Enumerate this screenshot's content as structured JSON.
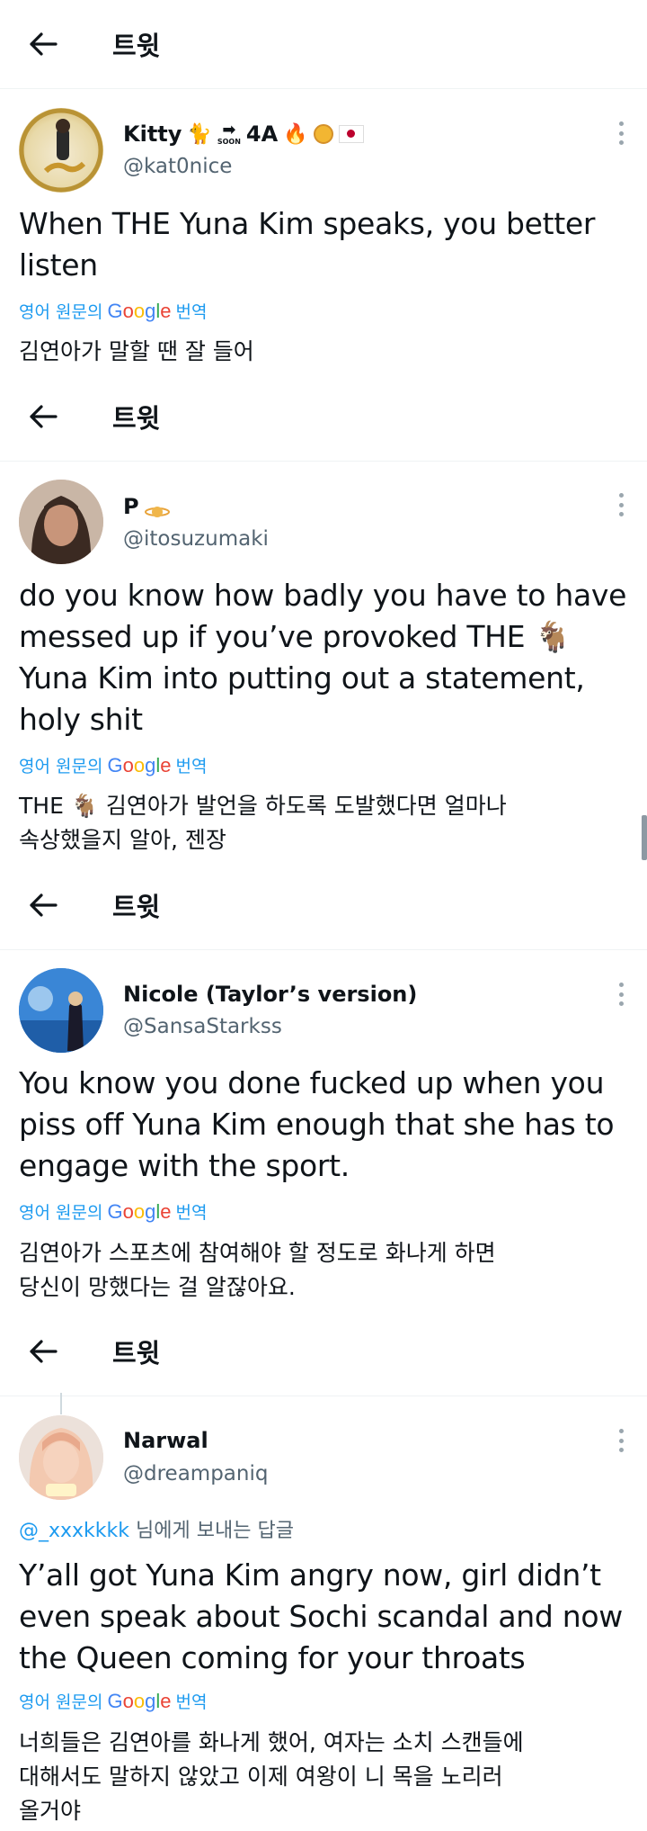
{
  "header_title": "트윗",
  "translate": {
    "prefix": "영어 원문의",
    "google": [
      "G",
      "o",
      "o",
      "g",
      "l",
      "e"
    ],
    "google_colors": [
      "#4285F4",
      "#EA4335",
      "#FBBC05",
      "#4285F4",
      "#34A853",
      "#EA4335"
    ],
    "suffix": "번역"
  },
  "tweets": [
    {
      "name": "Kitty",
      "name_extra": "SOON",
      "name_extra2": "4A",
      "handle": "@kat0nice",
      "text": [
        "When THE Yuna Kim speaks, you better",
        "listen"
      ],
      "translation": [
        "김연아가 말할 땐 잘 들어"
      ]
    },
    {
      "name": "P",
      "handle": "@itosuzumaki",
      "text": [
        "do you know how badly you have to have",
        "messed up if you’ve provoked THE",
        "Yuna Kim into putting out a statement,",
        "holy shit"
      ],
      "translation": [
        "THE",
        "김연아가 발언을 하도록 도발했다면 얼마나",
        "속상했을지 알아, 젠장"
      ]
    },
    {
      "name": "Nicole (Taylor’s version)",
      "handle": "@SansaStarkss",
      "text": [
        "You know you done fucked up when you",
        "piss off Yuna Kim enough that she has to",
        "engage with the sport."
      ],
      "translation": [
        "김연아가 스포츠에 참여해야 할 정도로 화나게 하면",
        "당신이 망했다는 걸 알잖아요."
      ]
    },
    {
      "name": "Narwal",
      "handle": "@dreampaniq",
      "reply_mention": "@_xxxkkkk",
      "reply_suffix": "님에게 보내는 답글",
      "text": [
        "Y’all got Yuna Kim angry now, girl didn’t",
        "even speak about Sochi scandal and now",
        "the Queen coming for your throats"
      ],
      "translation": [
        "너희들은 김연아를 화나게 했어, 여자는 소치 스캔들에",
        "대해서도 말하지 않았고 이제 여왕이 니 목을 노리러",
        "올거야"
      ]
    }
  ]
}
